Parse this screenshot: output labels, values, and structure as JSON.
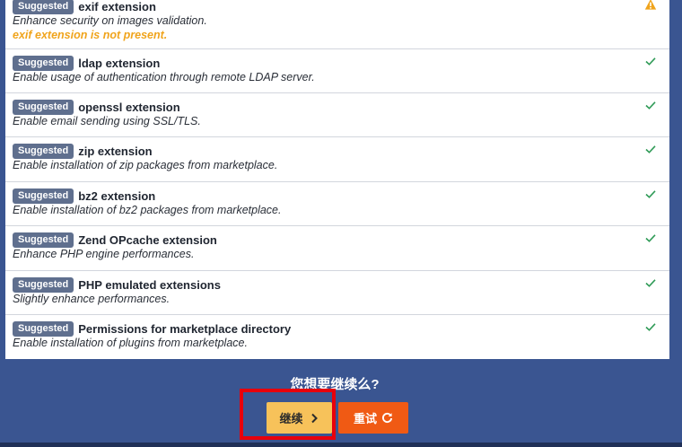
{
  "requirements": [
    {
      "badge": "Suggested",
      "title": "exif extension",
      "description": "Enhance security on images validation.",
      "warning": "exif extension is not present.",
      "status": "warning",
      "status_icon": "warning-icon"
    },
    {
      "badge": "Suggested",
      "title": "ldap extension",
      "description": "Enable usage of authentication through remote LDAP server.",
      "status": "ok",
      "status_icon": "check-icon"
    },
    {
      "badge": "Suggested",
      "title": "openssl extension",
      "description": "Enable email sending using SSL/TLS.",
      "status": "ok",
      "status_icon": "check-icon"
    },
    {
      "badge": "Suggested",
      "title": "zip extension",
      "description": "Enable installation of zip packages from marketplace.",
      "status": "ok",
      "status_icon": "check-icon"
    },
    {
      "badge": "Suggested",
      "title": "bz2 extension",
      "description": "Enable installation of bz2 packages from marketplace.",
      "status": "ok",
      "status_icon": "check-icon"
    },
    {
      "badge": "Suggested",
      "title": "Zend OPcache extension",
      "description": "Enhance PHP engine performances.",
      "status": "ok",
      "status_icon": "check-icon"
    },
    {
      "badge": "Suggested",
      "title": "PHP emulated extensions",
      "description": "Slightly enhance performances.",
      "status": "ok",
      "status_icon": "check-icon"
    },
    {
      "badge": "Suggested",
      "title": "Permissions for marketplace directory",
      "description": "Enable installation of plugins from marketplace.",
      "status": "ok",
      "status_icon": "check-icon"
    }
  ],
  "footer": {
    "question": "您想要继续么?",
    "continue_label": "继续",
    "retry_label": "重试"
  },
  "colors": {
    "background": "#3a5591",
    "badge": "#5f6f8e",
    "warning": "#f0a41c",
    "ok": "#2e9a56",
    "continue_button": "#f7c25a",
    "retry_button": "#f05a14",
    "highlight": "#e8000b"
  }
}
